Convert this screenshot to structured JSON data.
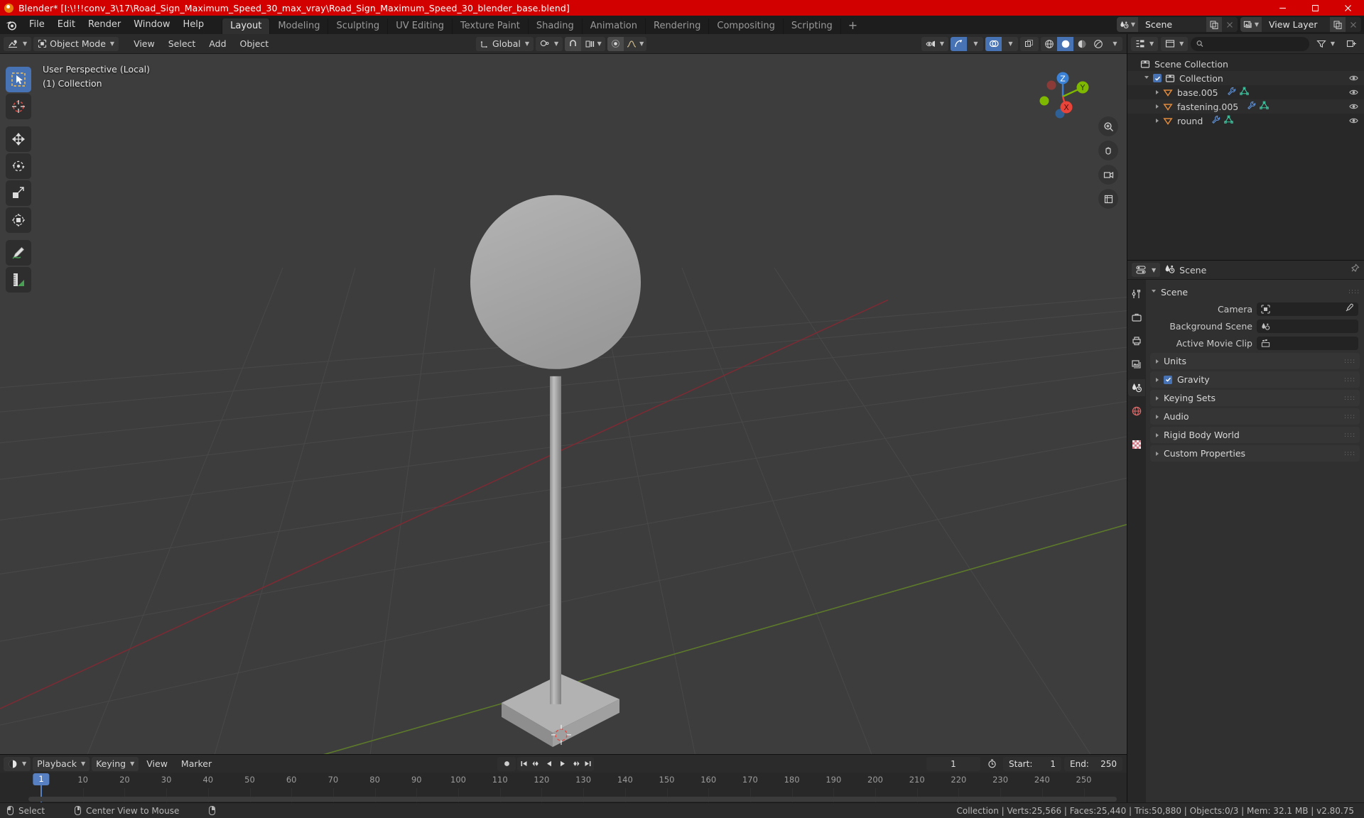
{
  "titlebar": {
    "app": "Blender*",
    "filepath": "[I:\\!!!conv_3\\17\\Road_Sign_Maximum_Speed_30_max_vray\\Road_Sign_Maximum_Speed_30_blender_base.blend]",
    "full": "Blender* [I:\\!!!conv_3\\17\\Road_Sign_Maximum_Speed_30_max_vray\\Road_Sign_Maximum_Speed_30_blender_base.blend]",
    "minimize": "—",
    "maximize": "□",
    "close": "✕",
    "bg_color": "#d30000"
  },
  "topbar": {
    "menus": [
      "File",
      "Edit",
      "Render",
      "Window",
      "Help"
    ],
    "workspaces": [
      {
        "label": "Layout",
        "active": true
      },
      {
        "label": "Modeling",
        "active": false
      },
      {
        "label": "Sculpting",
        "active": false
      },
      {
        "label": "UV Editing",
        "active": false
      },
      {
        "label": "Texture Paint",
        "active": false
      },
      {
        "label": "Shading",
        "active": false
      },
      {
        "label": "Animation",
        "active": false
      },
      {
        "label": "Rendering",
        "active": false
      },
      {
        "label": "Compositing",
        "active": false
      },
      {
        "label": "Scripting",
        "active": false
      }
    ],
    "add_workspace": "+",
    "scene_name": "Scene",
    "viewlayer_name": "View Layer"
  },
  "viewport_header": {
    "mode": "Object Mode",
    "menus": [
      "View",
      "Select",
      "Add",
      "Object"
    ],
    "orientation": "Global"
  },
  "viewport": {
    "perspective_text": "User Perspective (Local)",
    "collection_text": "(1) Collection",
    "gizmo_axes": [
      {
        "label": "Z",
        "color": "#3b82d6"
      },
      {
        "label": "Y",
        "color": "#7fb800"
      },
      {
        "label": "X",
        "color": "#e8443a"
      }
    ],
    "tools": [
      "select-box-tool",
      "cursor-tool",
      "move-tool",
      "rotate-tool",
      "scale-tool",
      "transform-tool",
      "annotate-tool",
      "measure-tool"
    ]
  },
  "timeline": {
    "menus": [
      "Playback",
      "Keying",
      "View",
      "Marker"
    ],
    "current_frame": "1",
    "start_label": "Start:",
    "start_value": "1",
    "end_label": "End:",
    "end_value": "250",
    "ticks": [
      "10",
      "20",
      "30",
      "40",
      "50",
      "60",
      "70",
      "80",
      "90",
      "100",
      "110",
      "120",
      "130",
      "140",
      "150",
      "160",
      "170",
      "180",
      "190",
      "200",
      "210",
      "220",
      "230",
      "240",
      "250"
    ],
    "playhead_label": "1"
  },
  "outliner": {
    "title": "Scene Collection",
    "search_placeholder": "",
    "rows": [
      {
        "label": "Scene Collection",
        "indent": 0,
        "type": "collection",
        "expand": "",
        "eye": false
      },
      {
        "label": "Collection",
        "indent": 1,
        "type": "collection",
        "expand": "down",
        "eye": true,
        "checkbox": true
      },
      {
        "label": "base.005",
        "indent": 2,
        "type": "mesh",
        "expand": "right",
        "eye": true
      },
      {
        "label": "fastening.005",
        "indent": 2,
        "type": "mesh",
        "expand": "right",
        "eye": true
      },
      {
        "label": "round",
        "indent": 2,
        "type": "mesh",
        "expand": "right",
        "eye": true
      }
    ]
  },
  "properties": {
    "breadcrumb": "Scene",
    "panel_title": "Scene",
    "rows": [
      {
        "label": "Camera",
        "value": "",
        "icon": "camera-icon",
        "eyedropper": true
      },
      {
        "label": "Background Scene",
        "value": "",
        "icon": "scene-icon",
        "eyedropper": false
      },
      {
        "label": "Active Movie Clip",
        "value": "",
        "icon": "clip-icon",
        "eyedropper": false
      }
    ],
    "sections": [
      {
        "label": "Units",
        "checkbox": false
      },
      {
        "label": "Gravity",
        "checkbox": true
      },
      {
        "label": "Keying Sets",
        "checkbox": false
      },
      {
        "label": "Audio",
        "checkbox": false
      },
      {
        "label": "Rigid Body World",
        "checkbox": false
      },
      {
        "label": "Custom Properties",
        "checkbox": false
      }
    ],
    "tabs": [
      "tool-tab",
      "render-tab",
      "output-tab",
      "viewlayer-tab",
      "scene-tab",
      "world-tab",
      "texture-tab"
    ]
  },
  "statusbar": {
    "select": "Select",
    "center_view": "Center View to Mouse",
    "stats": "Collection | Verts:25,566 | Faces:25,440 | Tris:50,880 | Objects:0/3 | Mem: 32.1 MB | v2.80.75"
  }
}
